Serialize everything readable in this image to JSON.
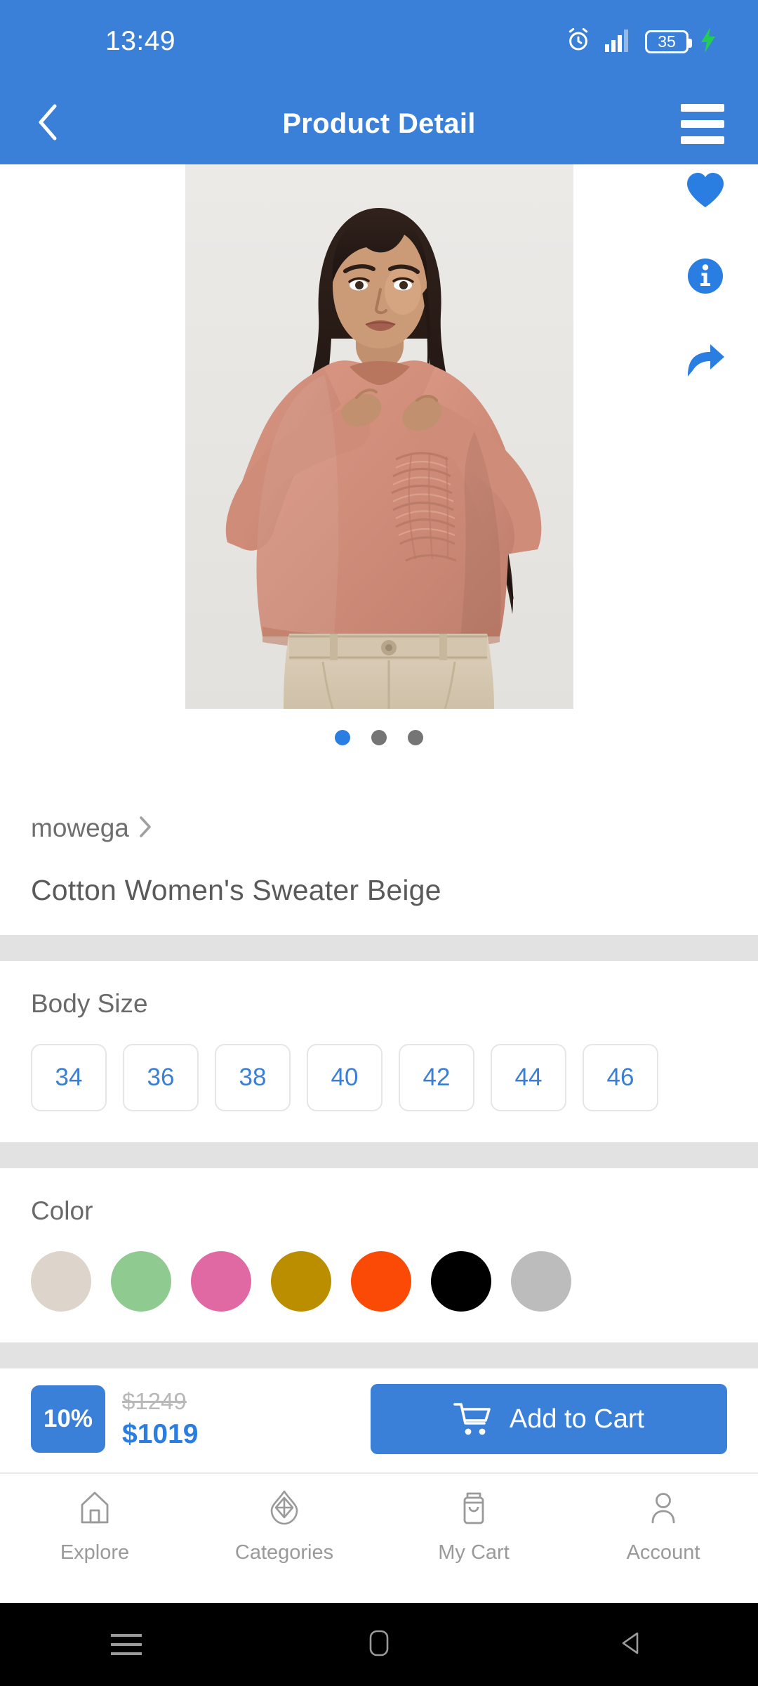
{
  "status_bar": {
    "time": "13:49",
    "battery_percent": "35",
    "icons": [
      "alarm-clock-icon",
      "signal-bars-icon",
      "battery-icon",
      "charging-bolt-icon"
    ]
  },
  "app_bar": {
    "title": "Product Detail",
    "back_icon": "chevron-left-icon",
    "menu_icon": "hamburger-menu-icon"
  },
  "gallery": {
    "actions": [
      {
        "name": "favorite",
        "icon": "heart-icon"
      },
      {
        "name": "info",
        "icon": "info-circle-icon"
      },
      {
        "name": "share",
        "icon": "share-arrow-icon"
      }
    ],
    "dots_total": 3,
    "dots_active_index": 0,
    "image_alt": "Model wearing dusty rose ruched-sleeve cotton sweater with beige trousers"
  },
  "product": {
    "brand": "mowega",
    "brand_chevron_icon": "chevron-right-icon",
    "title": "Cotton Women's Sweater Beige"
  },
  "body_size": {
    "label": "Body Size",
    "options": [
      "34",
      "36",
      "38",
      "40",
      "42",
      "44",
      "46"
    ]
  },
  "color": {
    "label": "Color",
    "options": [
      {
        "name": "beige",
        "hex": "#ddd4cb"
      },
      {
        "name": "green",
        "hex": "#8fca91"
      },
      {
        "name": "pink",
        "hex": "#e069a3"
      },
      {
        "name": "gold",
        "hex": "#bb8e00"
      },
      {
        "name": "orange",
        "hex": "#fb4a06"
      },
      {
        "name": "black",
        "hex": "#000000"
      },
      {
        "name": "silver",
        "hex": "#bcbcbc"
      }
    ]
  },
  "price_bar": {
    "discount_badge": "10%",
    "original_price": "$1249",
    "current_price": "$1019",
    "add_to_cart_label": "Add to Cart",
    "cart_icon": "shopping-cart-icon"
  },
  "bottom_nav": {
    "items": [
      {
        "label": "Explore",
        "icon": "home-icon"
      },
      {
        "label": "Categories",
        "icon": "diamond-icon"
      },
      {
        "label": "My Cart",
        "icon": "shopping-bag-icon"
      },
      {
        "label": "Account",
        "icon": "person-icon"
      }
    ]
  },
  "system_nav": {
    "buttons": [
      {
        "name": "recents",
        "icon": "recents-lines-icon"
      },
      {
        "name": "home",
        "icon": "home-square-icon"
      },
      {
        "name": "back",
        "icon": "back-triangle-icon"
      }
    ]
  },
  "colors": {
    "primary_blue": "#3b80d8",
    "accent_blue": "#2a7de1",
    "band_gray": "#e2e2e2",
    "text_gray": "#5a5a5a"
  }
}
